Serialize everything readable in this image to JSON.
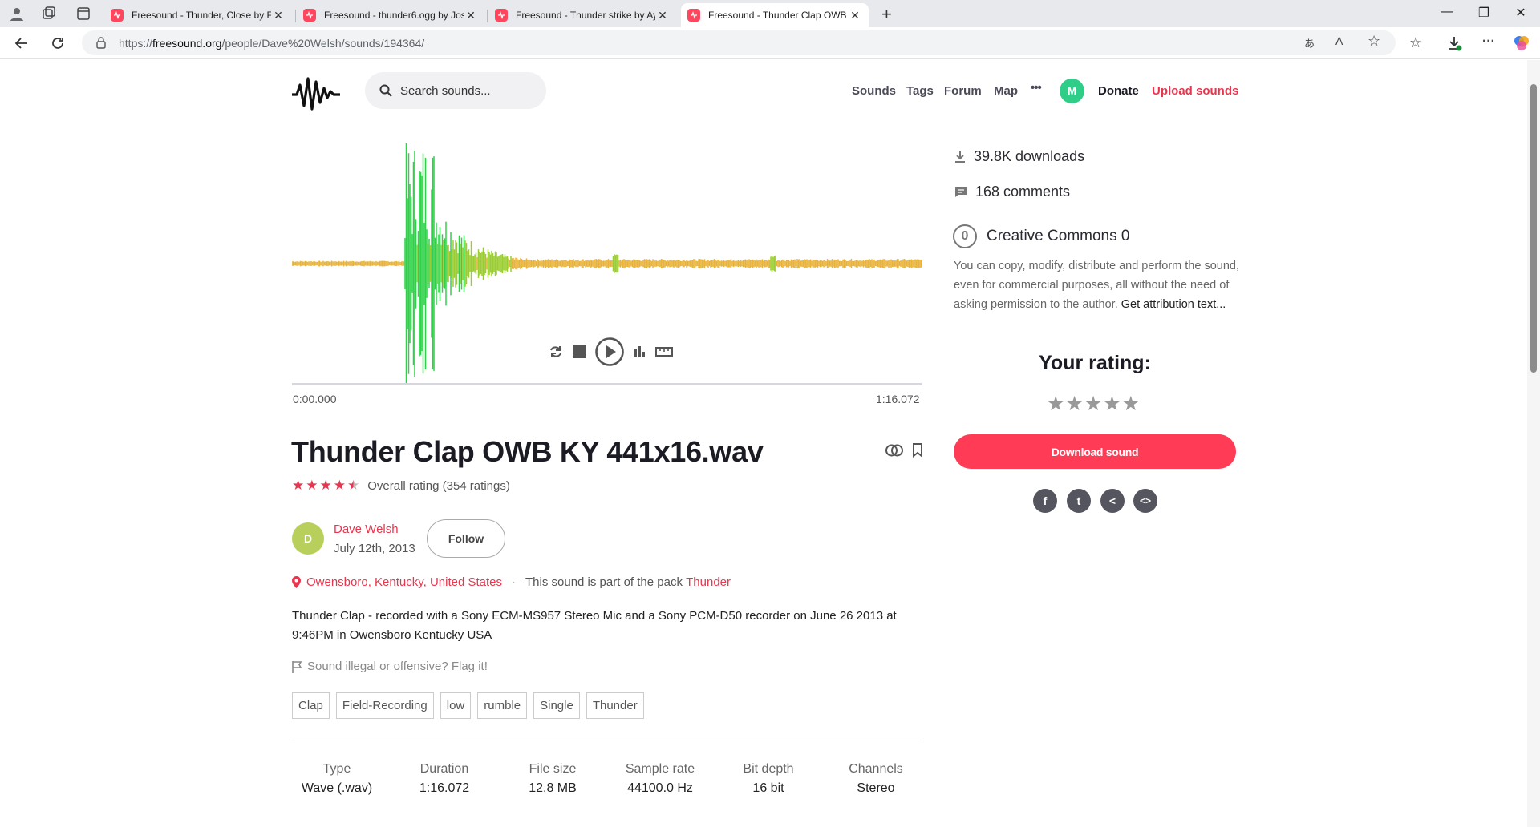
{
  "browser": {
    "tabs": [
      {
        "title": "Freesound - Thunder, Close by Fi",
        "active": false
      },
      {
        "title": "Freesound - thunder6.ogg by Jos",
        "active": false
      },
      {
        "title": "Freesound - Thunder strike by Ay",
        "active": false
      },
      {
        "title": "Freesound - Thunder Clap OWB K",
        "active": true
      }
    ],
    "url_prefix": "https://",
    "url_host": "freesound.org",
    "url_path": "/people/Dave%20Welsh/sounds/194364/"
  },
  "site": {
    "search_placeholder": "Search sounds...",
    "nav": [
      "Sounds",
      "Tags",
      "Forum",
      "Map"
    ],
    "more": "•••",
    "user_initial": "M",
    "donate": "Donate",
    "upload": "Upload sounds"
  },
  "player": {
    "time_start": "0:00.000",
    "time_end": "1:16.072",
    "colors": {
      "low": "#e8b33a",
      "mid": "#9acd32",
      "high": "#31d04a"
    }
  },
  "sound": {
    "title": "Thunder Clap OWB KY 441x16.wav",
    "rating_value": 4.5,
    "rating_text": "Overall rating (354 ratings)",
    "author_initial": "D",
    "author": "Dave Welsh",
    "date": "July 12th, 2013",
    "follow": "Follow",
    "location": "Owensboro, Kentucky, United States",
    "separator": "·",
    "pack_prefix": "This sound is part of the pack",
    "pack": "Thunder",
    "description": "Thunder Clap - recorded with a Sony ECM-MS957 Stereo Mic and a Sony PCM-D50 recorder on June 26 2013 at 9:46PM in Owensboro Kentucky USA",
    "flag": "Sound illegal or offensive? Flag it!",
    "tags": [
      "Clap",
      "Field-Recording",
      "low",
      "rumble",
      "Single",
      "Thunder"
    ],
    "meta": [
      {
        "k": "Type",
        "v": "Wave (.wav)"
      },
      {
        "k": "Duration",
        "v": "1:16.072"
      },
      {
        "k": "File size",
        "v": "12.8 MB"
      },
      {
        "k": "Sample rate",
        "v": "44100.0 Hz"
      },
      {
        "k": "Bit depth",
        "v": "16 bit"
      },
      {
        "k": "Channels",
        "v": "Stereo"
      }
    ]
  },
  "sidebar": {
    "downloads": "39.8K downloads",
    "comments": "168 comments",
    "license_glyph": "0",
    "license": "Creative Commons 0",
    "license_text": "You can copy, modify, distribute and perform the sound, even for commercial purposes, all without the need of asking permission to the author.",
    "license_link": "Get attribution text...",
    "your_rating": "Your rating:",
    "empty_stars": "★★★★★",
    "download": "Download sound",
    "share": [
      {
        "icon": "facebook-icon",
        "glyph": "f"
      },
      {
        "icon": "twitter-icon",
        "glyph": "t"
      },
      {
        "icon": "share-icon",
        "glyph": "<"
      },
      {
        "icon": "embed-icon",
        "glyph": "<>"
      }
    ]
  }
}
